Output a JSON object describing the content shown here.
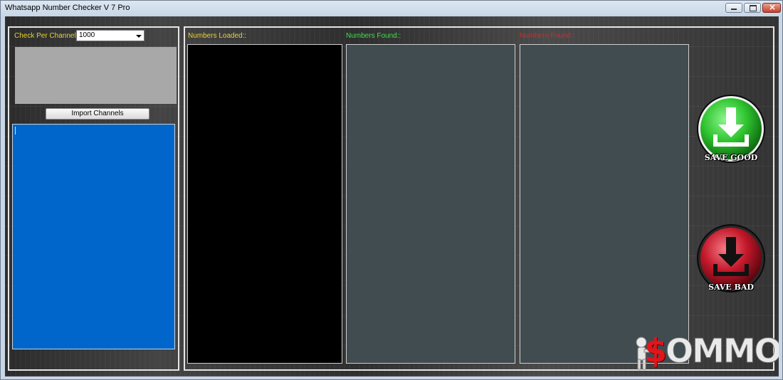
{
  "window": {
    "title": "Whatsapp Number Checker V 7 Pro"
  },
  "left_panel": {
    "check_label": "Check Per Channel::",
    "check_value": "1000",
    "import_button": "Import Channels"
  },
  "lists": {
    "loaded_label": "Numbers Loaded::",
    "found_label": "Numbers Found::",
    "notfound_label": "Numbers Found::"
  },
  "actions": {
    "save_good": "SAVE GOOD",
    "save_bad": "SAVE BAD"
  },
  "watermark": {
    "dollar": "$",
    "text": "OMMO"
  },
  "colors": {
    "loaded_label": "#e8d22e",
    "found_label": "#3fe04a",
    "notfound_label": "#e5221f",
    "channels_bg": "#0066cc",
    "loaded_bg": "#000000",
    "found_bg": "#414c50",
    "save_good": "#2fc42f",
    "save_bad": "#c3182a"
  }
}
